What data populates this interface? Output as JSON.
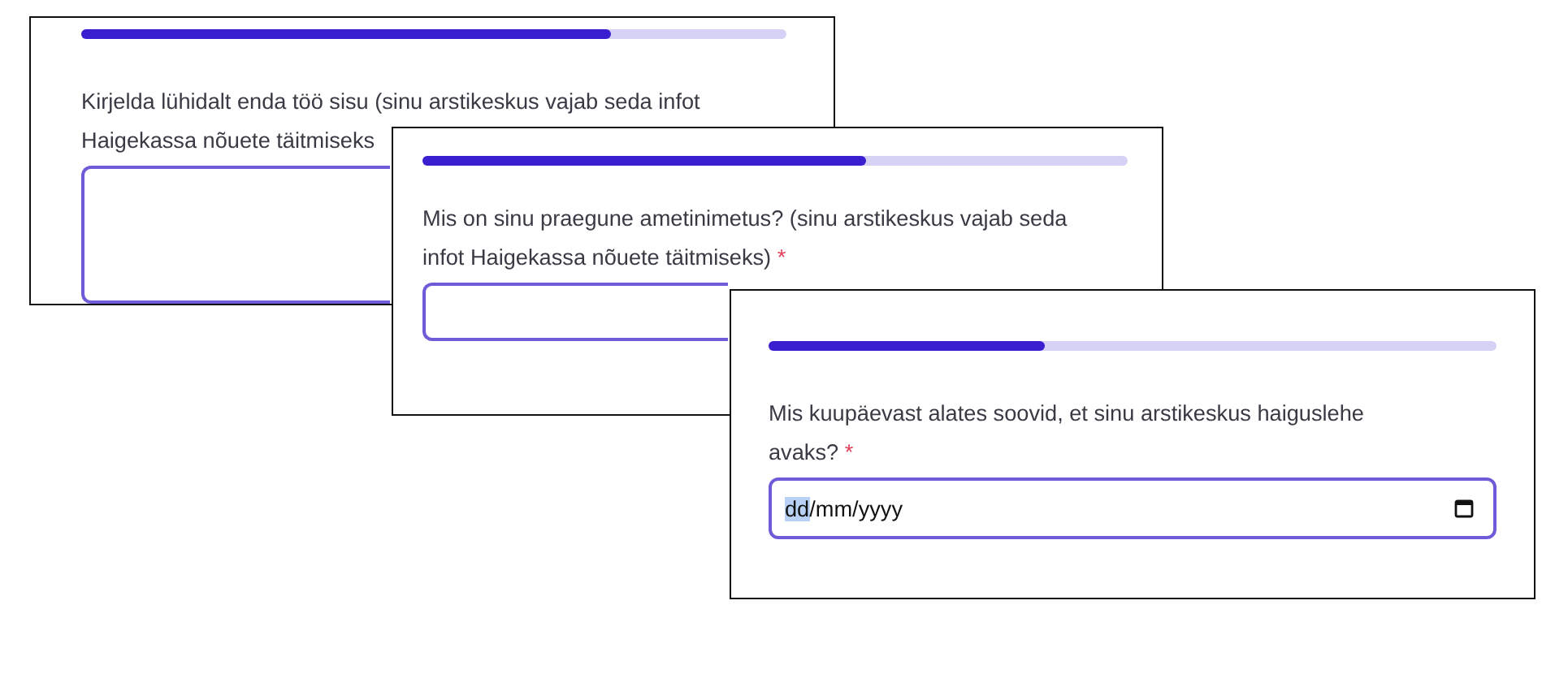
{
  "steps": [
    {
      "progress": {
        "level": 0.75
      },
      "question": "Kirjelda lühidalt enda töö sisu (sinu arstikeskus vajab seda infot Haigekassa nõuete täitmiseks",
      "field": {
        "kind": "textarea"
      }
    },
    {
      "progress": {
        "level": 0.63
      },
      "question": "Mis on sinu praegune ametinimetus? (sinu arstikeskus vajab seda infot Haigekassa nõuete täitmiseks)",
      "required_mark": "*",
      "field": {
        "kind": "text"
      }
    },
    {
      "progress": {
        "level": 0.38
      },
      "question": "Mis kuupäevast alates soovid, et sinu arstikeskus haiguslehe avaks?",
      "required_mark": "*",
      "field": {
        "kind": "date",
        "placeholder": "dd/mm/yyyy",
        "focused": true
      }
    }
  ]
}
